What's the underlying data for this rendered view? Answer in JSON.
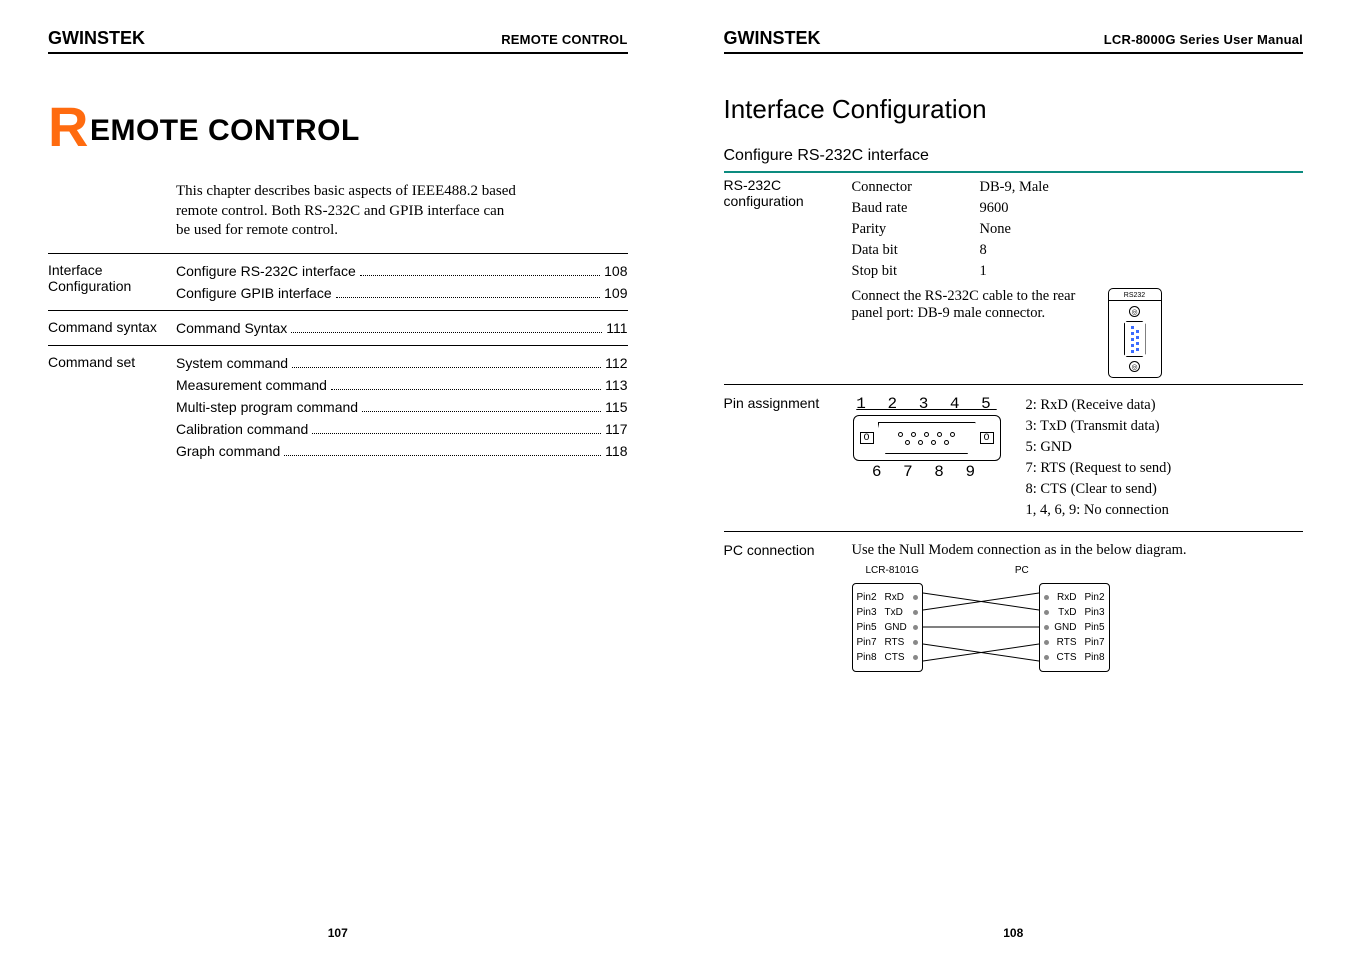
{
  "left": {
    "brand": "GWINSTEK",
    "header_title": "REMOTE CONTROL",
    "chapter_dropcap": "R",
    "chapter_rest": "EMOTE CONTROL",
    "intro": "This chapter describes basic aspects of IEEE488.2 based remote control. Both RS-232C and GPIB interface can be used for remote control.",
    "toc": [
      {
        "label": "Interface Configuration",
        "items": [
          {
            "text": "Configure RS-232C interface",
            "page": "108"
          },
          {
            "text": "Configure GPIB interface",
            "page": "109"
          }
        ]
      },
      {
        "label": "Command syntax",
        "items": [
          {
            "text": "Command Syntax",
            "page": "111"
          }
        ]
      },
      {
        "label": "Command set",
        "items": [
          {
            "text": "System command",
            "page": "112"
          },
          {
            "text": "Measurement command",
            "page": "113"
          },
          {
            "text": "Multi-step program command",
            "page": "115"
          },
          {
            "text": "Calibration command",
            "page": "117"
          },
          {
            "text": "Graph command",
            "page": "118"
          }
        ]
      }
    ],
    "page_number": "107"
  },
  "right": {
    "brand": "GWINSTEK",
    "header_title": "LCR-8000G Series User Manual",
    "h1": "Interface Configuration",
    "h2": "Configure RS-232C interface",
    "config_label": "RS-232C configuration",
    "specs": [
      {
        "k": "Connector",
        "v": "DB-9, Male"
      },
      {
        "k": "Baud rate",
        "v": "9600"
      },
      {
        "k": "Parity",
        "v": "None"
      },
      {
        "k": "Data bit",
        "v": "8"
      },
      {
        "k": "Stop bit",
        "v": "1"
      }
    ],
    "connect_note": "Connect the RS-232C cable to the rear panel port: DB-9 male connector.",
    "port_label": "RS232",
    "pin_label": "Pin assignment",
    "db9_top": "1 2 3 4 5",
    "db9_bottom": "6 7 8 9",
    "pins": [
      "2: RxD (Receive data)",
      "3: TxD (Transmit data)",
      "5: GND",
      "7: RTS (Request to send)",
      "8: CTS (Clear to send)",
      "1, 4, 6, 9: No connection"
    ],
    "pc_label": "PC connection",
    "pc_note": "Use the Null Modem connection as in the below diagram.",
    "nm_left_title": "LCR-8101G",
    "nm_right_title": "PC",
    "nm_rows": [
      {
        "lp": "Pin2",
        "ls": "RxD",
        "rs": "RxD",
        "rp": "Pin2"
      },
      {
        "lp": "Pin3",
        "ls": "TxD",
        "rs": "TxD",
        "rp": "Pin3"
      },
      {
        "lp": "Pin5",
        "ls": "GND",
        "rs": "GND",
        "rp": "Pin5"
      },
      {
        "lp": "Pin7",
        "ls": "RTS",
        "rs": "RTS",
        "rp": "Pin7"
      },
      {
        "lp": "Pin8",
        "ls": "CTS",
        "rs": "CTS",
        "rp": "Pin8"
      }
    ],
    "page_number": "108"
  }
}
